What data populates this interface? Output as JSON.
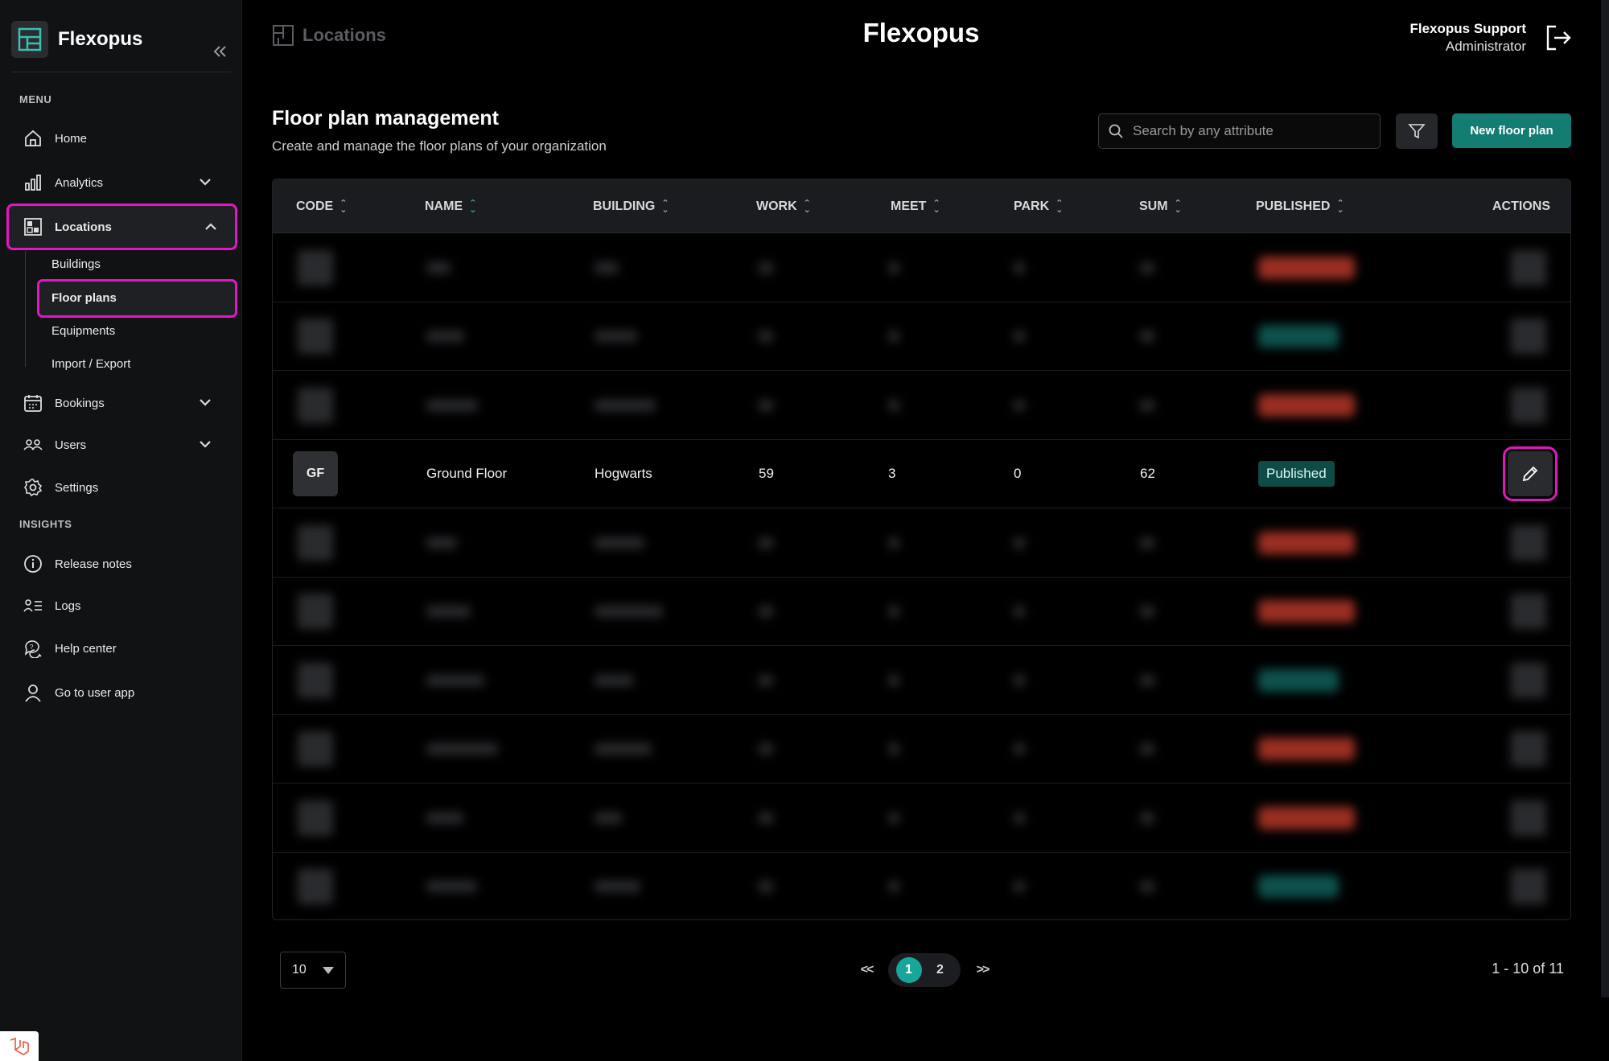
{
  "app": {
    "name": "Flexopus"
  },
  "sidebar": {
    "collapse_icon": "double-chevron-left-icon",
    "menu_title": "MENU",
    "insights_title": "INSIGHTS",
    "items": [
      {
        "label": "Home",
        "icon": "home-icon"
      },
      {
        "label": "Analytics",
        "icon": "bar-chart-icon"
      },
      {
        "label": "Locations",
        "icon": "floorplan-icon"
      },
      {
        "label": "Bookings",
        "icon": "calendar-icon"
      },
      {
        "label": "Users",
        "icon": "users-icon"
      },
      {
        "label": "Settings",
        "icon": "gear-icon"
      }
    ],
    "location_sub": [
      "Buildings",
      "Floor plans",
      "Equipments",
      "Import / Export"
    ],
    "insights": [
      {
        "label": "Release notes",
        "icon": "info-icon"
      },
      {
        "label": "Logs",
        "icon": "list-icon"
      },
      {
        "label": "Help center",
        "icon": "help-chat-icon"
      },
      {
        "label": "Go to user app",
        "icon": "user-icon"
      }
    ]
  },
  "header": {
    "breadcrumb": "Locations",
    "title": "Flexopus",
    "user_name": "Flexopus Support",
    "user_role": "Administrator"
  },
  "page": {
    "title": "Floor plan management",
    "subtitle": "Create and manage the floor plans of your organization",
    "search_placeholder": "Search by any attribute",
    "new_button": "New floor plan"
  },
  "table": {
    "columns": [
      "CODE",
      "NAME",
      "BUILDING",
      "WORK",
      "MEET",
      "PARK",
      "SUM",
      "PUBLISHED",
      "ACTIONS"
    ],
    "visible_row": {
      "code": "GF",
      "name": "Ground Floor",
      "building": "Hogwarts",
      "work": "59",
      "meet": "3",
      "park": "0",
      "sum": "62",
      "published": "Published"
    }
  },
  "pagination": {
    "page_size": "10",
    "first": "<<",
    "pages": [
      "1",
      "2"
    ],
    "current": "1",
    "last": ">>",
    "range": "1 - 10 of 11"
  },
  "colors": {
    "accent": "#17a79a",
    "highlight": "#e415c4",
    "unpublished": "#c0392b"
  }
}
